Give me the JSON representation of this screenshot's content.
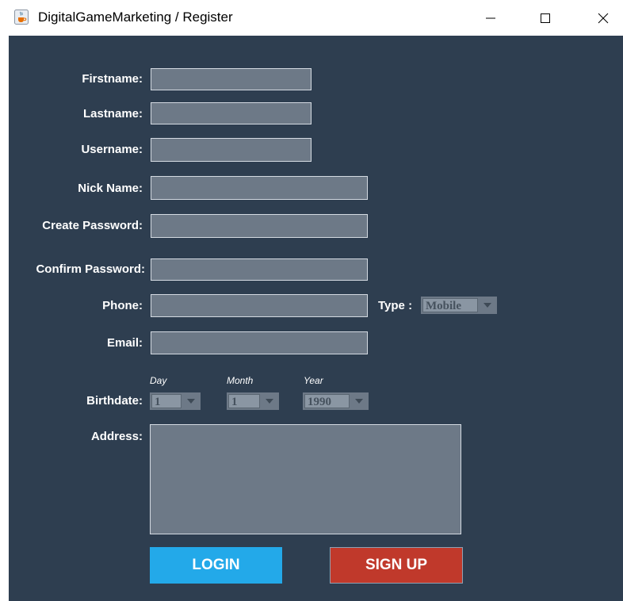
{
  "window": {
    "title": "DigitalGameMarketing / Register"
  },
  "form": {
    "firstname_label": "Firstname:",
    "firstname_value": "",
    "lastname_label": "Lastname:",
    "lastname_value": "",
    "username_label": "Username:",
    "username_value": "",
    "nickname_label": "Nick Name:",
    "nickname_value": "",
    "create_password_label": "Create Password:",
    "create_password_value": "",
    "confirm_password_label": "Confirm Password:",
    "confirm_password_value": "",
    "phone_label": "Phone:",
    "phone_value": "",
    "type_label": "Type :",
    "type_selected": "Mobile",
    "email_label": "Email:",
    "email_value": "",
    "birthdate_label": "Birthdate:",
    "day_caption": "Day",
    "day_selected": "1",
    "month_caption": "Month",
    "month_selected": "1",
    "year_caption": "Year",
    "year_selected": "1990",
    "address_label": "Address:",
    "address_value": ""
  },
  "buttons": {
    "login_label": "LOGIN",
    "signup_label": "SIGN UP"
  },
  "colors": {
    "panel_bg": "#2e3e50",
    "field_bg": "#6d7987",
    "login_bg": "#23a9e9",
    "signup_bg": "#c0392b"
  },
  "icons": {
    "app": "java-cup-icon",
    "minimize": "minimize-icon",
    "maximize": "maximize-icon",
    "close": "close-icon",
    "dropdown": "triangle-down-icon"
  }
}
